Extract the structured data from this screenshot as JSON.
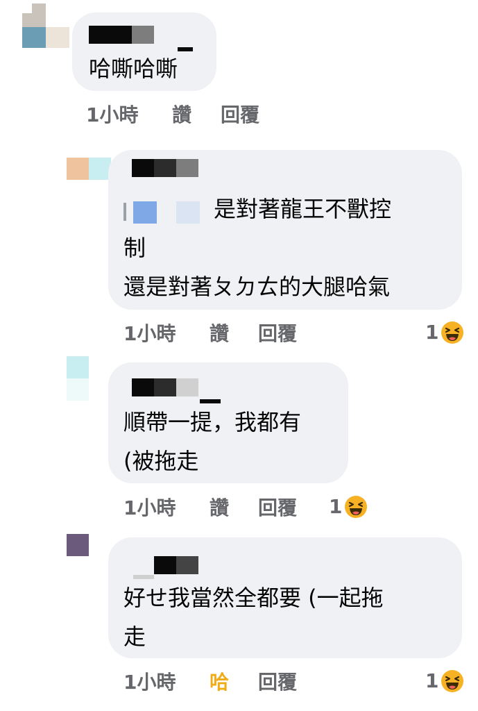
{
  "comments": [
    {
      "text_lines": [
        "哈嘶哈嘶"
      ],
      "time": "1小時",
      "like_label": "讚",
      "reply_label": "回覆",
      "reaction_count": ""
    },
    {
      "text_lines": [
        "是對著龍王不獸控",
        "制",
        "還是對著ㄆㄉㄊ的大腿哈氣"
      ],
      "time": "1小時",
      "like_label": "讚",
      "reply_label": "回覆",
      "reaction_count": "1"
    },
    {
      "text_lines": [
        "順帶一提，我都有",
        "(被拖走"
      ],
      "time": "1小時",
      "like_label": "讚",
      "reply_label": "回覆",
      "reaction_count": "1"
    },
    {
      "text_lines": [
        "好せ我當然全都要 (一起拖",
        "走"
      ],
      "time": "1小時",
      "like_label": "哈",
      "reply_label": "回覆",
      "reaction_count": "1"
    }
  ],
  "reaction_icon": "haha-emoji-icon",
  "colors": {
    "bubble": "#eff1f4",
    "meta_text": "#65676b",
    "liked_haha": "#f0ac18",
    "haha_emoji": "#f7b125"
  }
}
